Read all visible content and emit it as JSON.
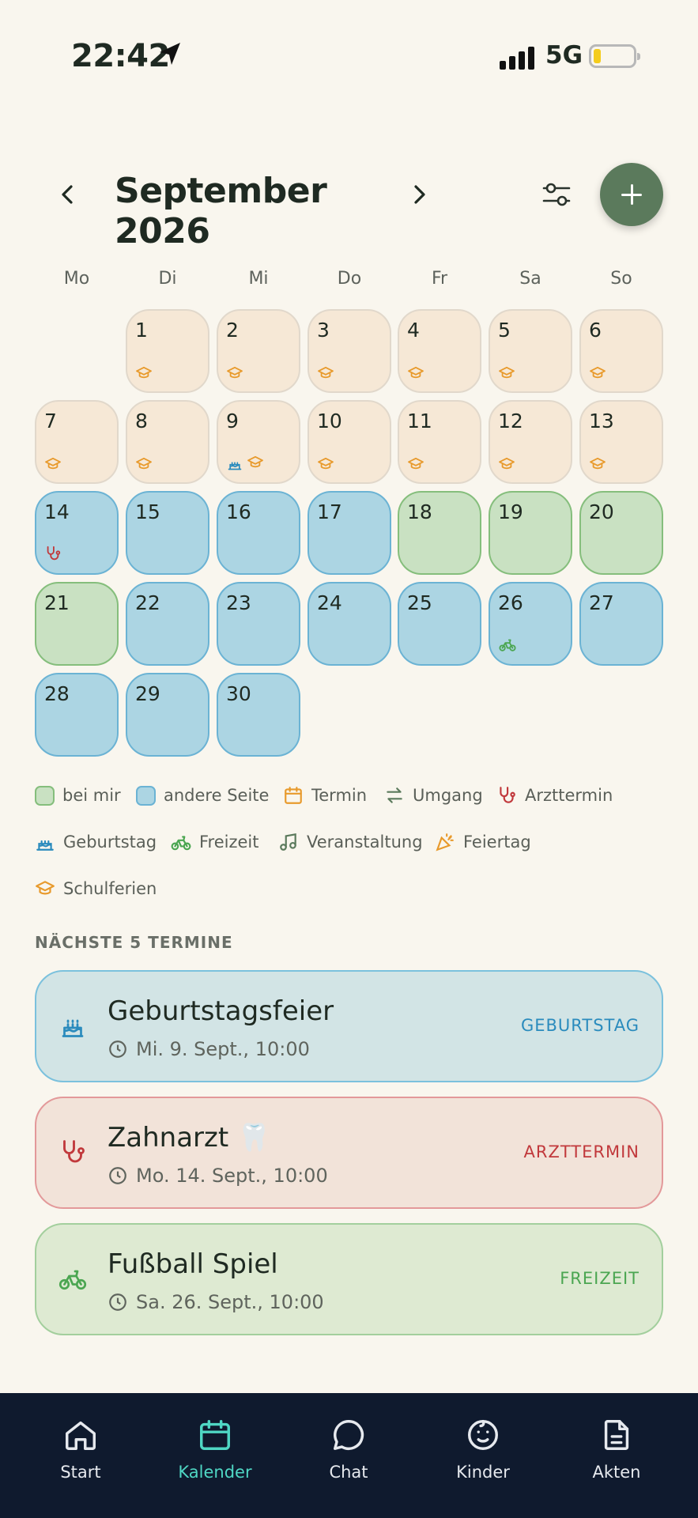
{
  "status_bar": {
    "time": "22:42",
    "network": "5G"
  },
  "header": {
    "month_title": "September 2026"
  },
  "weekdays": [
    "Mo",
    "Di",
    "Mi",
    "Do",
    "Fr",
    "Sa",
    "So"
  ],
  "calendar": {
    "days": [
      {
        "n": "1",
        "type": "vacation",
        "icons": [
          "graduation-cap-icon"
        ]
      },
      {
        "n": "2",
        "type": "vacation",
        "icons": [
          "graduation-cap-icon"
        ]
      },
      {
        "n": "3",
        "type": "vacation",
        "icons": [
          "graduation-cap-icon"
        ]
      },
      {
        "n": "4",
        "type": "vacation",
        "icons": [
          "graduation-cap-icon"
        ]
      },
      {
        "n": "5",
        "type": "vacation",
        "icons": [
          "graduation-cap-icon"
        ]
      },
      {
        "n": "6",
        "type": "vacation",
        "icons": [
          "graduation-cap-icon"
        ]
      },
      {
        "n": "7",
        "type": "vacation",
        "icons": [
          "graduation-cap-icon"
        ]
      },
      {
        "n": "8",
        "type": "vacation",
        "icons": [
          "graduation-cap-icon"
        ]
      },
      {
        "n": "9",
        "type": "vacation",
        "icons": [
          "birthday-cake-icon",
          "graduation-cap-icon"
        ]
      },
      {
        "n": "10",
        "type": "vacation",
        "icons": [
          "graduation-cap-icon"
        ]
      },
      {
        "n": "11",
        "type": "vacation",
        "icons": [
          "graduation-cap-icon"
        ]
      },
      {
        "n": "12",
        "type": "vacation",
        "icons": [
          "graduation-cap-icon"
        ]
      },
      {
        "n": "13",
        "type": "vacation",
        "icons": [
          "graduation-cap-icon"
        ]
      },
      {
        "n": "14",
        "type": "other",
        "icons": [
          "stethoscope-icon"
        ]
      },
      {
        "n": "15",
        "type": "other",
        "icons": []
      },
      {
        "n": "16",
        "type": "other",
        "icons": []
      },
      {
        "n": "17",
        "type": "other",
        "icons": []
      },
      {
        "n": "18",
        "type": "mine",
        "icons": []
      },
      {
        "n": "19",
        "type": "mine",
        "icons": []
      },
      {
        "n": "20",
        "type": "mine",
        "icons": []
      },
      {
        "n": "21",
        "type": "mine",
        "icons": []
      },
      {
        "n": "22",
        "type": "other",
        "icons": []
      },
      {
        "n": "23",
        "type": "other",
        "icons": []
      },
      {
        "n": "24",
        "type": "other",
        "icons": []
      },
      {
        "n": "25",
        "type": "other",
        "icons": []
      },
      {
        "n": "26",
        "type": "other",
        "icons": [
          "bike-icon"
        ]
      },
      {
        "n": "27",
        "type": "other",
        "icons": []
      },
      {
        "n": "28",
        "type": "other",
        "icons": []
      },
      {
        "n": "29",
        "type": "other",
        "icons": []
      },
      {
        "n": "30",
        "type": "other",
        "icons": []
      }
    ]
  },
  "legend": [
    {
      "label": "bei mir",
      "icon": "swatch-mine"
    },
    {
      "label": "andere Seite",
      "icon": "swatch-other"
    },
    {
      "label": "Termin",
      "icon": "calendar-icon"
    },
    {
      "label": "Umgang",
      "icon": "swap-arrows-icon"
    },
    {
      "label": "Arzttermin",
      "icon": "stethoscope-icon"
    },
    {
      "label": "Geburtstag",
      "icon": "birthday-cake-icon"
    },
    {
      "label": "Freizeit",
      "icon": "bike-icon"
    },
    {
      "label": "Veranstaltung",
      "icon": "music-note-icon"
    },
    {
      "label": "Feiertag",
      "icon": "party-popper-icon"
    },
    {
      "label": "Schulferien",
      "icon": "graduation-cap-icon"
    }
  ],
  "upcoming": {
    "title": "NÄCHSTE 5 TERMINE",
    "events": [
      {
        "title": "Geburtstagsfeier",
        "datetime": "Mi. 9. Sept., 10:00",
        "tag": "GEBURTSTAG",
        "icon": "birthday-cake-icon"
      },
      {
        "title": "Zahnarzt 🦷",
        "datetime": "Mo. 14. Sept., 10:00",
        "tag": "ARZTTERMIN",
        "icon": "stethoscope-icon"
      },
      {
        "title": "Fußball Spiel",
        "datetime": "Sa. 26. Sept., 10:00",
        "tag": "FREIZEIT",
        "icon": "bike-icon"
      }
    ]
  },
  "tabs": [
    {
      "label": "Start",
      "icon": "home-icon"
    },
    {
      "label": "Kalender",
      "icon": "calendar-icon",
      "active": true
    },
    {
      "label": "Chat",
      "icon": "chat-bubble-icon"
    },
    {
      "label": "Kinder",
      "icon": "child-face-icon"
    },
    {
      "label": "Akten",
      "icon": "document-icon"
    }
  ],
  "colors": {
    "background": "#f9f6ee",
    "accent_green": "#5b7a5c",
    "vacation": "#f6e8d6",
    "other_side": "#acd5e3",
    "mine": "#c9e1c2",
    "tab_active": "#4fd7c4",
    "tabbar_bg": "#0f1a2e"
  }
}
